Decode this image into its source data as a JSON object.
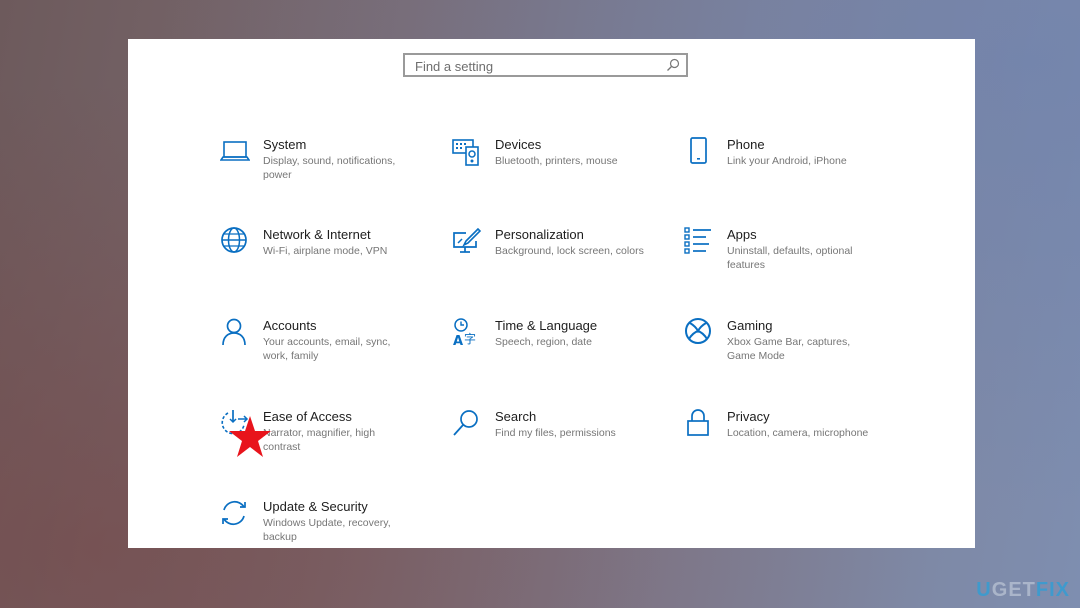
{
  "search": {
    "placeholder": "Find a setting",
    "icon": "search-icon"
  },
  "accent_color": "#0a6fc2",
  "tiles": [
    {
      "id": "system",
      "title": "System",
      "desc": "Display, sound, notifications, power",
      "icon": "laptop-icon"
    },
    {
      "id": "devices",
      "title": "Devices",
      "desc": "Bluetooth, printers, mouse",
      "icon": "devices-icon"
    },
    {
      "id": "phone",
      "title": "Phone",
      "desc": "Link your Android, iPhone",
      "icon": "phone-icon"
    },
    {
      "id": "network",
      "title": "Network & Internet",
      "desc": "Wi-Fi, airplane mode, VPN",
      "icon": "globe-icon"
    },
    {
      "id": "personalization",
      "title": "Personalization",
      "desc": "Background, lock screen, colors",
      "icon": "paintbrush-icon"
    },
    {
      "id": "apps",
      "title": "Apps",
      "desc": "Uninstall, defaults, optional features",
      "icon": "apps-list-icon"
    },
    {
      "id": "accounts",
      "title": "Accounts",
      "desc": "Your accounts, email, sync, work, family",
      "icon": "person-icon"
    },
    {
      "id": "time-language",
      "title": "Time & Language",
      "desc": "Speech, region, date",
      "icon": "time-language-icon"
    },
    {
      "id": "gaming",
      "title": "Gaming",
      "desc": "Xbox Game Bar, captures, Game Mode",
      "icon": "xbox-icon"
    },
    {
      "id": "ease-of-access",
      "title": "Ease of Access",
      "desc": "Narrator, magnifier, high contrast",
      "icon": "ease-of-access-icon"
    },
    {
      "id": "search",
      "title": "Search",
      "desc": "Find my files, permissions",
      "icon": "magnifier-icon"
    },
    {
      "id": "privacy",
      "title": "Privacy",
      "desc": "Location, camera, microphone",
      "icon": "lock-icon"
    },
    {
      "id": "update-security",
      "title": "Update & Security",
      "desc": "Windows Update, recovery, backup",
      "icon": "sync-icon"
    }
  ],
  "annotation": {
    "marker": "red-star",
    "target": "Ease of Access",
    "color": "#e8141c"
  },
  "watermark": {
    "part1": "U",
    "part2": "G",
    "part3": "E",
    "part4": "T",
    "part5": "FIX"
  }
}
